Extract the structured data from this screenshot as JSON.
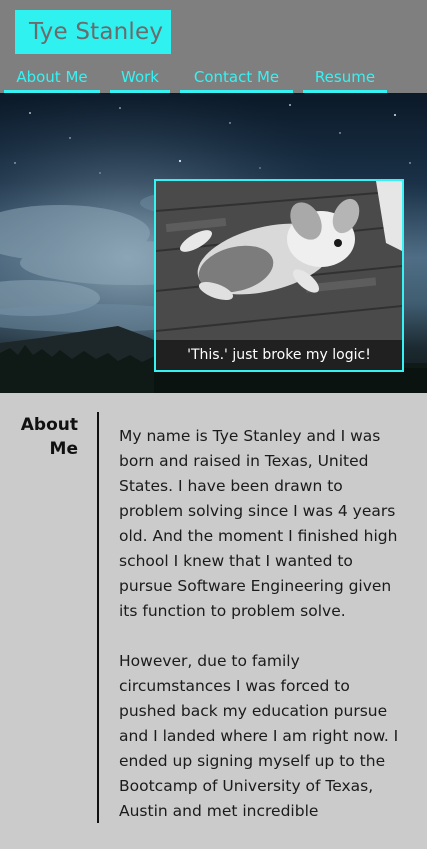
{
  "header": {
    "brand": "Tye Stanley",
    "colors": {
      "accent": "#37f2f3",
      "header_bg": "#7f7f7f"
    }
  },
  "nav": {
    "items": [
      "About Me",
      "Work",
      "Contact Me",
      "Resume"
    ]
  },
  "hero": {
    "photo_caption": "'This.' just broke my logic!",
    "photo_subject": "corgi-puppy-photo"
  },
  "about": {
    "heading": "About Me",
    "paragraphs": [
      "My name is Tye Stanley and I was born and raised in Texas, United States. I have been drawn to problem solving since I was 4 years old. And the moment I finished high school I knew that I wanted to pursue Software Engineering given its function to problem solve.",
      "However, due to family circumstances I was forced to pushed back my education pursue and I landed where I am right now. I ended up signing myself up to the Bootcamp of University of Texas, Austin and met incredible"
    ]
  }
}
